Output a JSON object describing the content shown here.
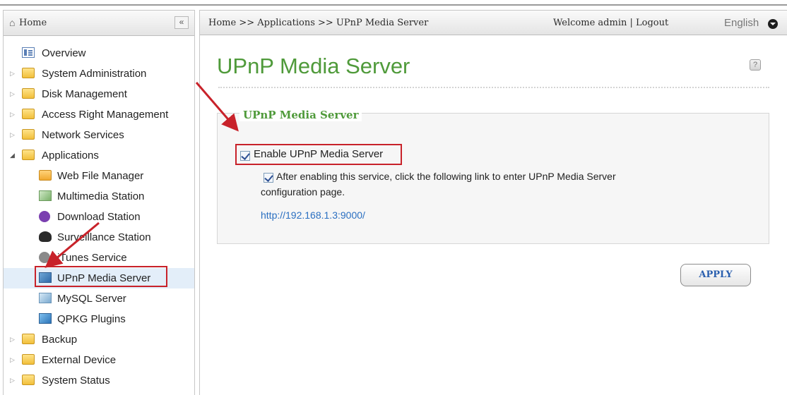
{
  "sidebar": {
    "home_label": "Home",
    "collapse_label": "«",
    "items": [
      {
        "label": "Overview"
      },
      {
        "label": "System Administration"
      },
      {
        "label": "Disk Management"
      },
      {
        "label": "Access Right Management"
      },
      {
        "label": "Network Services"
      },
      {
        "label": "Applications"
      },
      {
        "label": "Web File Manager"
      },
      {
        "label": "Multimedia Station"
      },
      {
        "label": "Download Station"
      },
      {
        "label": "Surveillance Station"
      },
      {
        "label": "iTunes Service"
      },
      {
        "label": "UPnP Media Server"
      },
      {
        "label": "MySQL Server"
      },
      {
        "label": "QPKG Plugins"
      },
      {
        "label": "Backup"
      },
      {
        "label": "External Device"
      },
      {
        "label": "System Status"
      }
    ]
  },
  "header": {
    "breadcrumb": "Home >> Applications >> UPnP Media Server",
    "welcome": "Welcome admin | Logout",
    "language": "English"
  },
  "main": {
    "title": "UPnP Media Server",
    "help": "?",
    "section_legend": "UPnP Media Server",
    "enable_label": "Enable UPnP Media Server",
    "after_text_line1": "After enabling this service, click the following link to enter UPnP Media Server",
    "after_text_line2": "configuration page.",
    "link": "http://192.168.1.3:9000/",
    "apply_label": "APPLY"
  },
  "colors": {
    "accent_green": "#4f9a3a",
    "link_blue": "#2a6fc1",
    "highlight_red": "#c8222a"
  }
}
